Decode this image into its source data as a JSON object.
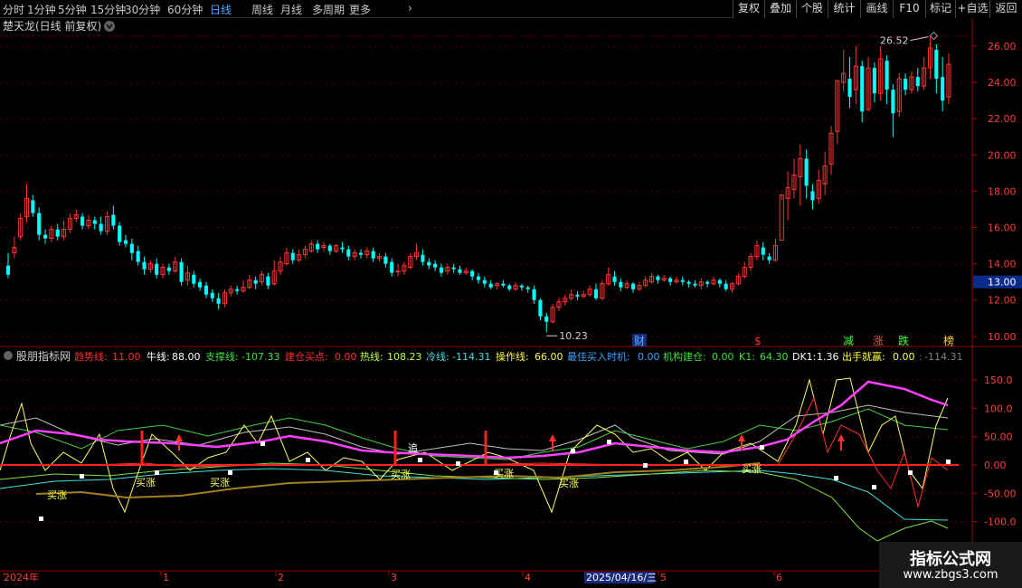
{
  "toolbar": {
    "periods": [
      "分时",
      "1分钟",
      "5分钟",
      "15分钟",
      "30分钟",
      "60分钟",
      "日线",
      "周线",
      "月线",
      "多周期",
      "更多"
    ],
    "active_period": "日线",
    "buttons": [
      "复权",
      "叠加",
      "个股",
      "统计",
      "画线",
      "F10",
      "标记",
      "+自选",
      "返回"
    ]
  },
  "main_panel": {
    "title": "楚天龙(日线 前复权)",
    "y_ticks": [
      "26.00",
      "24.00",
      "22.00",
      "20.00",
      "18.00",
      "16.00",
      "14.00",
      "12.00",
      "10.00"
    ],
    "price_tag": "13.00",
    "high_label": "26.52",
    "low_label": "10.23",
    "event_markers": [
      "财",
      "$",
      "减",
      "涨",
      "跌",
      "榜"
    ]
  },
  "indicator_panel": {
    "title": "股朋指标网",
    "params": [
      {
        "label": "趋势线:",
        "value": "11.00",
        "color": "#ff3030"
      },
      {
        "label": "牛线:",
        "value": "88.00",
        "color": "#ffffff"
      },
      {
        "label": "支撑线:",
        "value": "-107.33",
        "color": "#40e040"
      },
      {
        "label": "建仓买点:",
        "value": "0.00",
        "color": "#ff3030"
      },
      {
        "label": "热线:",
        "value": "108.23",
        "color": "#c0ff40"
      },
      {
        "label": "冷线:",
        "value": "-114.31",
        "color": "#40e0e0"
      },
      {
        "label": "操作线:",
        "value": "66.00",
        "color": "#ffff40"
      },
      {
        "label": "最佳买入时机:",
        "value": "0.00",
        "color": "#40a0ff"
      },
      {
        "label": "机构建仓:",
        "value": "0.00",
        "color": "#40e040"
      },
      {
        "label": "K1:",
        "value": "64.30",
        "color": "#40e040"
      },
      {
        "label": "DK1:",
        "value": "1.36",
        "color": "#ffffff"
      },
      {
        "label": "出手就赢:",
        "value": "0.00",
        "color": "#ffff40"
      },
      {
        "label": ":",
        "value": "-114.31",
        "color": "#808080"
      }
    ],
    "y_ticks": [
      "150.0",
      "100.0",
      "50.00",
      "0.00",
      "-50.00",
      "-100.0"
    ],
    "buy_label": "买涨",
    "chase_label": "追"
  },
  "time_axis": {
    "labels": [
      "2024年",
      "1",
      "2",
      "3",
      "4",
      "5",
      "6"
    ],
    "cursor_date": "2025/04/16/三"
  },
  "watermark": {
    "line1": "指标公式网",
    "line2": "www.zbgs3.com"
  },
  "chart_data": {
    "type": "candlestick",
    "up_color": "#ff3232",
    "down_color": "#00ffff",
    "ylim": [
      9.8,
      27.4
    ],
    "candles": [
      [
        13.9,
        13.4,
        14.6,
        13.2
      ],
      [
        14.6,
        14.9,
        15.5,
        14.3
      ],
      [
        15.5,
        16.5,
        16.8,
        15.3
      ],
      [
        16.6,
        17.6,
        18.4,
        16.3
      ],
      [
        17.5,
        16.8,
        17.8,
        16.6
      ],
      [
        16.8,
        15.6,
        17.1,
        15.3
      ],
      [
        15.6,
        15.4,
        15.9,
        15.1
      ],
      [
        15.4,
        15.9,
        16.1,
        15.2
      ],
      [
        15.9,
        15.5,
        16.2,
        15.3
      ],
      [
        15.5,
        15.9,
        16.4,
        15.3
      ],
      [
        15.9,
        16.5,
        16.8,
        15.7
      ],
      [
        16.5,
        16.7,
        17.0,
        16.3
      ],
      [
        16.6,
        16.1,
        16.8,
        15.9
      ],
      [
        16.1,
        16.4,
        16.7,
        15.9
      ],
      [
        16.4,
        16.2,
        16.6,
        15.9
      ],
      [
        16.2,
        15.8,
        16.6,
        15.6
      ],
      [
        15.8,
        16.6,
        16.9,
        15.6
      ],
      [
        16.7,
        16.1,
        17.2,
        15.9
      ],
      [
        16.1,
        15.2,
        16.3,
        15.0
      ],
      [
        15.3,
        15.1,
        15.6,
        14.9
      ],
      [
        15.1,
        14.6,
        15.4,
        14.2
      ],
      [
        14.7,
        14.1,
        15.0,
        13.9
      ],
      [
        14.1,
        13.7,
        14.4,
        13.4
      ],
      [
        13.7,
        14.0,
        14.2,
        13.5
      ],
      [
        14.0,
        13.4,
        14.3,
        13.2
      ],
      [
        13.4,
        13.8,
        14.0,
        13.2
      ],
      [
        13.8,
        13.6,
        14.0,
        13.4
      ],
      [
        13.6,
        14.1,
        14.4,
        13.5
      ],
      [
        14.1,
        13.0,
        14.3,
        12.8
      ],
      [
        13.1,
        13.5,
        13.9,
        12.8
      ],
      [
        13.4,
        12.9,
        13.6,
        12.7
      ],
      [
        13.0,
        12.7,
        13.2,
        12.5
      ],
      [
        12.8,
        12.3,
        13.0,
        12.1
      ],
      [
        12.4,
        12.1,
        12.6,
        11.9
      ],
      [
        12.1,
        11.8,
        12.4,
        11.5
      ],
      [
        11.8,
        12.4,
        12.6,
        11.6
      ],
      [
        12.4,
        12.6,
        12.8,
        12.2
      ],
      [
        12.6,
        12.5,
        12.8,
        12.3
      ],
      [
        12.5,
        12.7,
        13.1,
        12.4
      ],
      [
        12.7,
        13.1,
        13.4,
        12.6
      ],
      [
        13.1,
        12.9,
        13.3,
        12.6
      ],
      [
        13.0,
        13.4,
        13.6,
        12.8
      ],
      [
        13.3,
        12.8,
        13.5,
        12.6
      ],
      [
        12.9,
        13.6,
        14.2,
        12.8
      ],
      [
        13.6,
        14.1,
        14.4,
        13.4
      ],
      [
        14.0,
        14.6,
        14.9,
        13.9
      ],
      [
        14.6,
        14.2,
        14.8,
        14.0
      ],
      [
        14.2,
        14.5,
        14.8,
        14.1
      ],
      [
        14.5,
        14.8,
        15.0,
        14.3
      ],
      [
        14.7,
        15.1,
        15.3,
        14.6
      ],
      [
        15.1,
        14.8,
        15.3,
        14.6
      ],
      [
        14.9,
        15.0,
        15.2,
        14.7
      ],
      [
        15.0,
        14.7,
        15.1,
        14.5
      ],
      [
        14.7,
        15.0,
        15.1,
        14.6
      ],
      [
        14.9,
        14.8,
        15.2,
        14.6
      ],
      [
        14.8,
        14.4,
        15.0,
        14.2
      ],
      [
        14.4,
        14.6,
        14.8,
        14.2
      ],
      [
        14.6,
        14.5,
        14.8,
        14.3
      ],
      [
        14.5,
        14.7,
        14.9,
        14.3
      ],
      [
        14.7,
        14.3,
        14.9,
        14.1
      ],
      [
        14.3,
        14.4,
        14.6,
        14.1
      ],
      [
        14.4,
        14.0,
        14.6,
        13.8
      ],
      [
        14.1,
        13.5,
        14.3,
        13.3
      ],
      [
        13.6,
        13.6,
        14.0,
        13.3
      ],
      [
        13.6,
        13.9,
        14.1,
        13.4
      ],
      [
        13.8,
        14.4,
        14.6,
        13.7
      ],
      [
        14.4,
        14.6,
        15.1,
        14.2
      ],
      [
        14.5,
        14.1,
        14.8,
        13.9
      ],
      [
        14.1,
        13.9,
        14.3,
        13.7
      ],
      [
        14.0,
        13.8,
        14.2,
        13.6
      ],
      [
        13.8,
        13.5,
        14.0,
        13.3
      ],
      [
        13.6,
        13.8,
        14.0,
        13.4
      ],
      [
        13.8,
        13.7,
        14.0,
        13.5
      ],
      [
        13.7,
        13.5,
        13.9,
        13.4
      ],
      [
        13.5,
        13.6,
        13.8,
        13.4
      ],
      [
        13.6,
        13.3,
        13.7,
        13.1
      ],
      [
        13.3,
        13.1,
        13.5,
        12.9
      ],
      [
        13.1,
        12.9,
        13.3,
        12.7
      ],
      [
        12.9,
        12.7,
        13.1,
        12.6
      ],
      [
        12.8,
        12.9,
        13.0,
        12.6
      ],
      [
        12.9,
        12.8,
        13.1,
        12.7
      ],
      [
        12.8,
        12.6,
        12.9,
        12.5
      ],
      [
        12.6,
        12.8,
        13.0,
        12.5
      ],
      [
        12.8,
        12.7,
        12.9,
        12.5
      ],
      [
        12.7,
        12.6,
        12.8,
        12.4
      ],
      [
        12.6,
        12.0,
        12.8,
        11.8
      ],
      [
        12.0,
        11.1,
        12.1,
        10.9
      ],
      [
        11.1,
        10.8,
        11.3,
        10.23
      ],
      [
        10.8,
        11.6,
        11.8,
        10.7
      ],
      [
        11.6,
        11.9,
        12.1,
        11.4
      ],
      [
        11.9,
        12.1,
        12.3,
        11.7
      ],
      [
        12.1,
        12.3,
        12.6,
        12.0
      ],
      [
        12.3,
        12.2,
        12.5,
        12.0
      ],
      [
        12.2,
        12.3,
        12.5,
        12.1
      ],
      [
        12.3,
        12.6,
        12.8,
        12.2
      ],
      [
        12.6,
        12.1,
        12.9,
        12.0
      ],
      [
        12.1,
        12.9,
        13.1,
        12.0
      ],
      [
        12.9,
        13.4,
        13.8,
        12.8
      ],
      [
        13.3,
        13.0,
        13.6,
        12.8
      ],
      [
        13.0,
        12.7,
        13.2,
        12.5
      ],
      [
        12.7,
        12.9,
        13.1,
        12.6
      ],
      [
        12.9,
        12.6,
        13.0,
        12.4
      ],
      [
        12.6,
        12.8,
        13.0,
        12.5
      ],
      [
        12.8,
        13.1,
        13.3,
        12.7
      ],
      [
        13.0,
        13.3,
        13.5,
        12.9
      ],
      [
        13.3,
        13.1,
        13.4,
        12.9
      ],
      [
        13.1,
        13.2,
        13.4,
        13.0
      ],
      [
        13.2,
        13.0,
        13.3,
        12.8
      ],
      [
        13.0,
        13.1,
        13.3,
        12.9
      ],
      [
        13.1,
        13.0,
        13.3,
        12.8
      ],
      [
        13.0,
        12.9,
        13.1,
        12.7
      ],
      [
        12.9,
        12.8,
        13.1,
        12.7
      ],
      [
        12.8,
        13.0,
        13.2,
        12.6
      ],
      [
        13.0,
        12.9,
        13.1,
        12.7
      ],
      [
        12.9,
        13.1,
        13.3,
        12.8
      ],
      [
        13.1,
        12.9,
        13.2,
        12.7
      ],
      [
        12.9,
        12.6,
        13.1,
        12.5
      ],
      [
        12.6,
        12.9,
        13.0,
        12.4
      ],
      [
        12.9,
        13.3,
        13.5,
        12.8
      ],
      [
        13.3,
        13.8,
        14.1,
        13.2
      ],
      [
        13.8,
        14.4,
        14.6,
        13.6
      ],
      [
        14.4,
        15.0,
        15.3,
        14.2
      ],
      [
        14.9,
        14.5,
        15.2,
        14.2
      ],
      [
        14.4,
        14.2,
        14.6,
        14.0
      ],
      [
        14.2,
        15.0,
        15.4,
        14.1
      ],
      [
        15.3,
        17.8,
        17.8,
        17.5
      ],
      [
        17.6,
        18.2,
        19.1,
        16.4
      ],
      [
        18.1,
        18.9,
        19.8,
        17.6
      ],
      [
        18.8,
        19.8,
        20.6,
        17.2
      ],
      [
        19.8,
        18.3,
        20.3,
        17.6
      ],
      [
        18.0,
        17.5,
        18.4,
        17.0
      ],
      [
        17.6,
        18.6,
        19.2,
        17.3
      ],
      [
        18.4,
        19.4,
        20.2,
        17.8
      ],
      [
        19.5,
        21.2,
        21.6,
        18.9
      ],
      [
        21.3,
        24.1,
        24.1,
        20.6
      ],
      [
        24.0,
        24.5,
        25.8,
        23.5
      ],
      [
        24.2,
        23.2,
        25.4,
        22.6
      ],
      [
        23.6,
        24.9,
        26.0,
        22.8
      ],
      [
        24.9,
        22.4,
        25.2,
        21.8
      ],
      [
        22.5,
        24.8,
        25.4,
        22.4
      ],
      [
        24.8,
        23.4,
        25.1,
        22.9
      ],
      [
        23.4,
        25.3,
        26.0,
        23.0
      ],
      [
        25.2,
        23.6,
        25.5,
        22.8
      ],
      [
        23.6,
        22.3,
        23.9,
        21.0
      ],
      [
        22.4,
        24.2,
        24.5,
        22.1
      ],
      [
        24.2,
        23.6,
        24.5,
        23.3
      ],
      [
        23.6,
        24.3,
        24.6,
        23.4
      ],
      [
        24.3,
        23.8,
        24.8,
        23.5
      ],
      [
        23.8,
        24.8,
        25.4,
        23.6
      ],
      [
        24.8,
        25.9,
        26.52,
        24.2
      ],
      [
        25.8,
        24.2,
        26.1,
        23.4
      ],
      [
        24.3,
        23.0,
        25.4,
        22.4
      ],
      [
        23.2,
        25.0,
        25.6,
        22.8
      ]
    ],
    "high": 26.52,
    "low": 10.23
  }
}
